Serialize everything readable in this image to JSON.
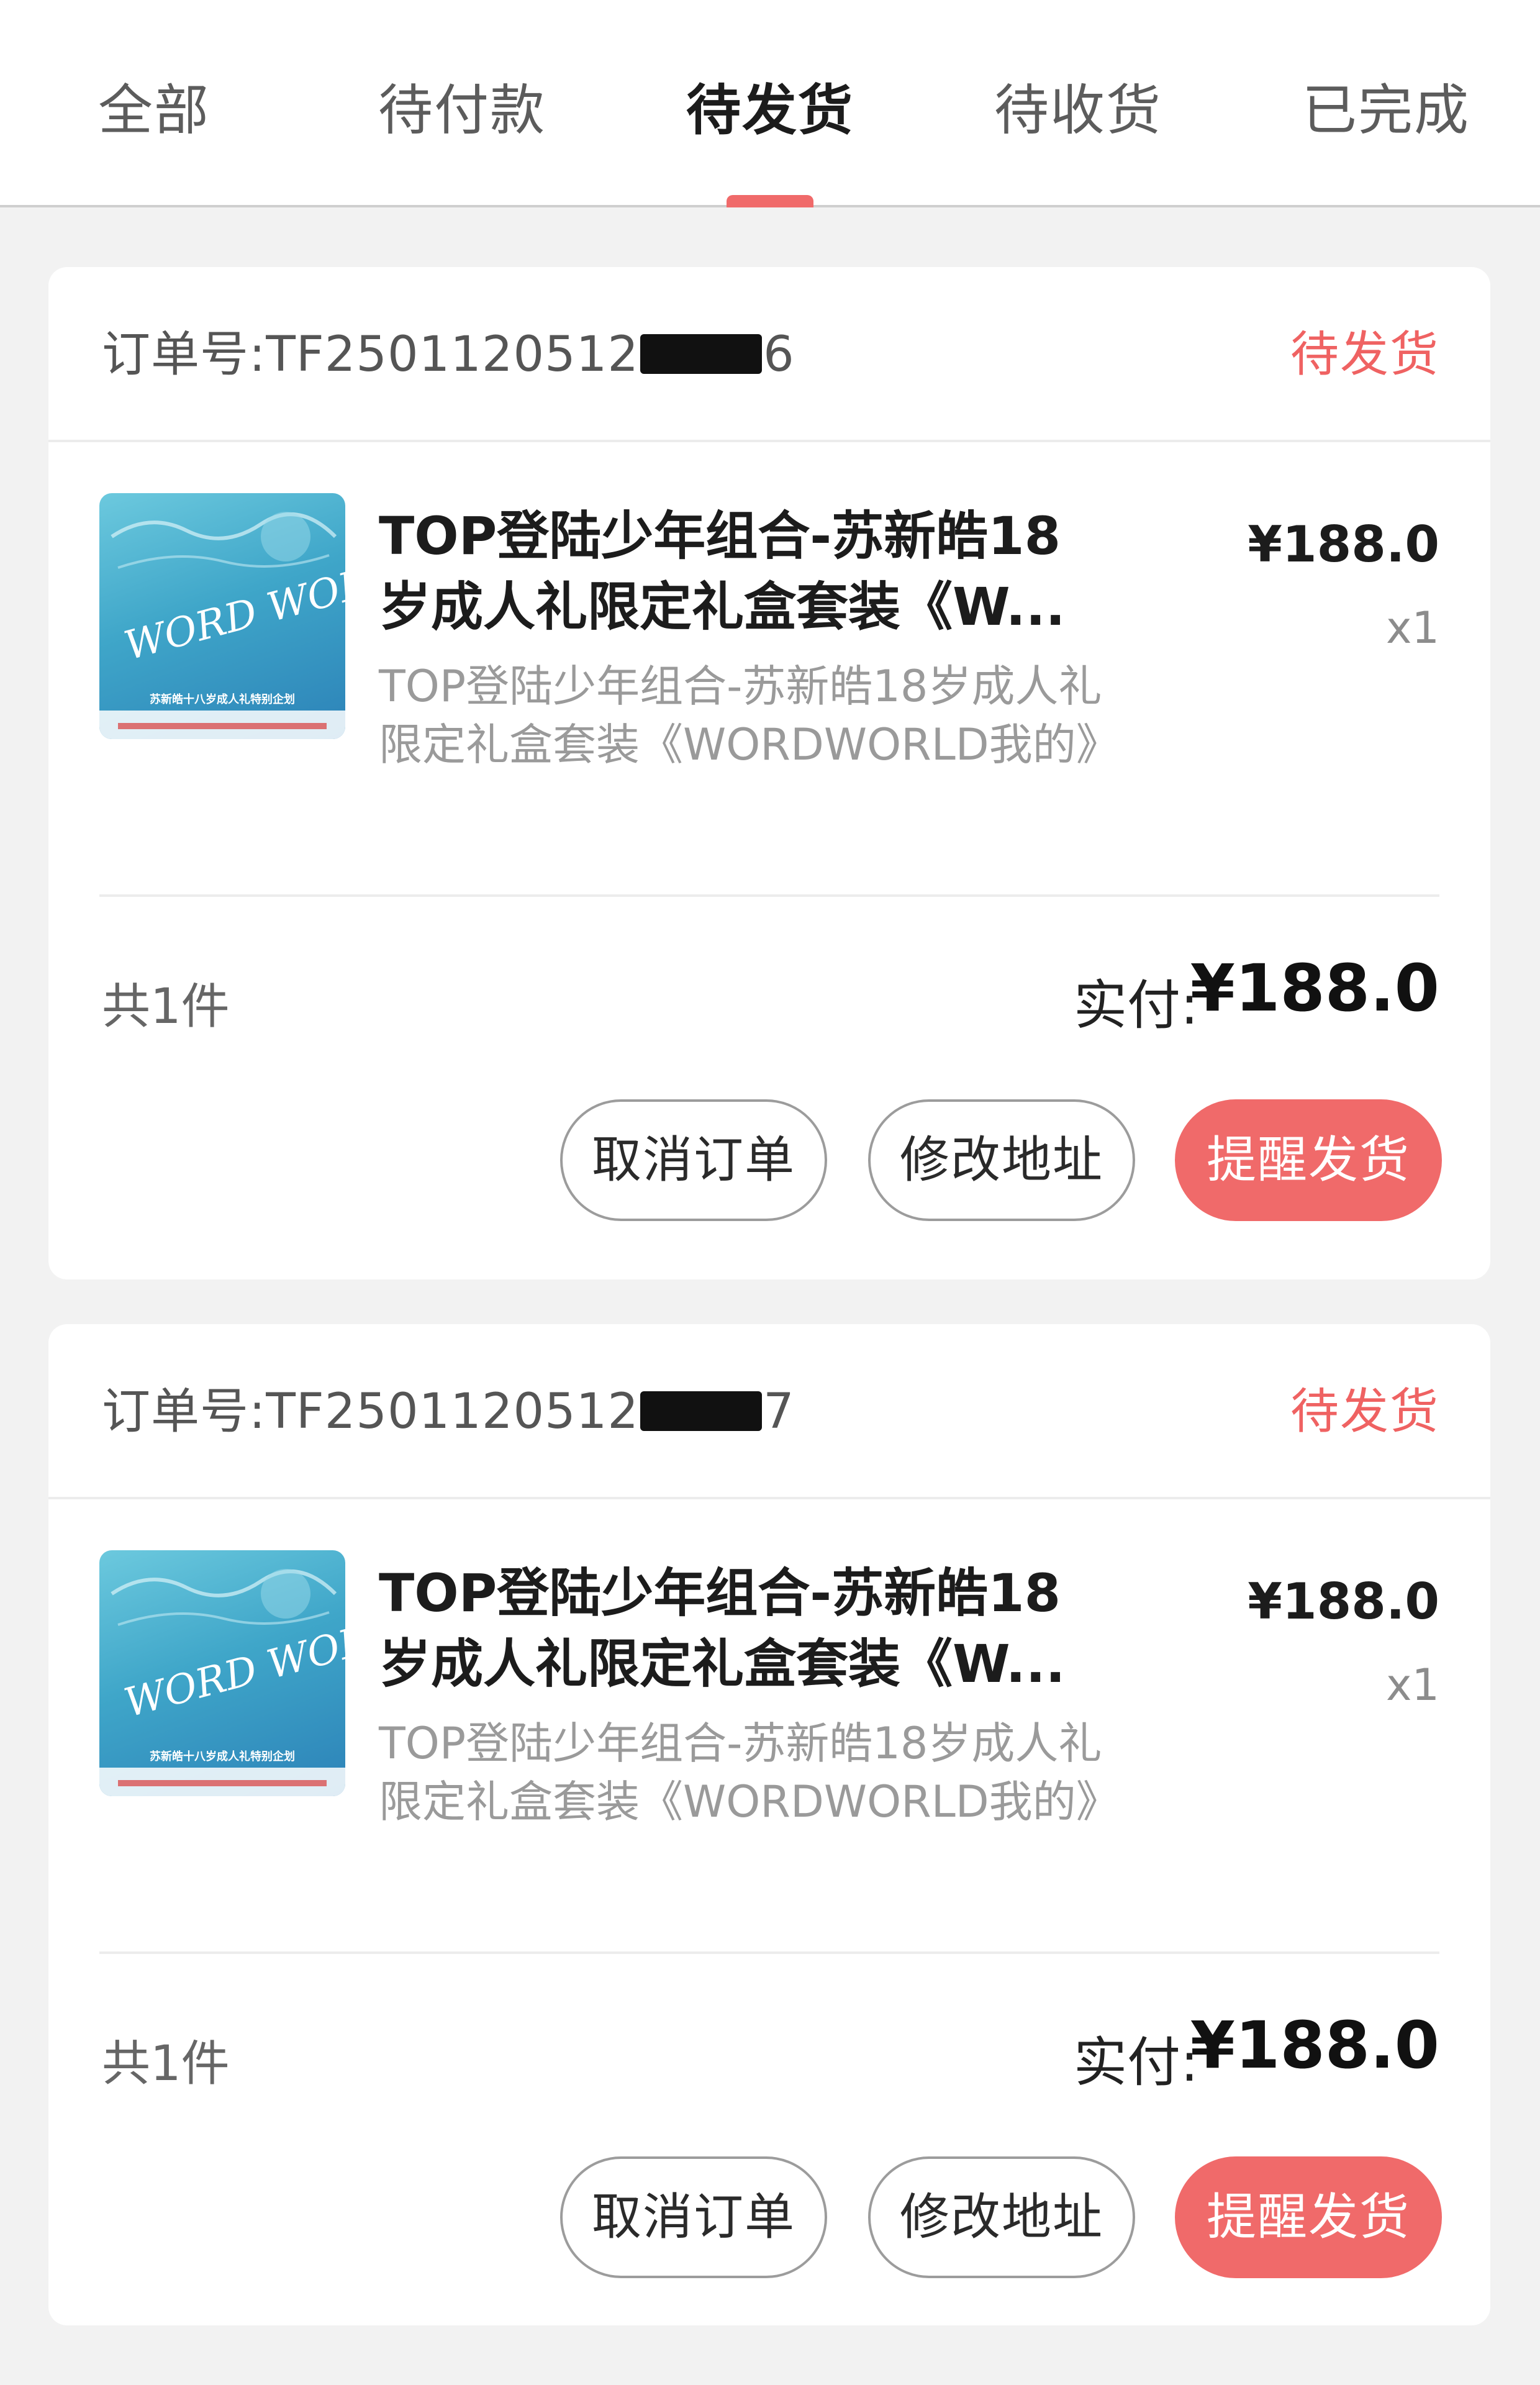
{
  "tabs": [
    {
      "label": "全部",
      "active": false
    },
    {
      "label": "待付款",
      "active": false
    },
    {
      "label": "待发货",
      "active": true
    },
    {
      "label": "待收货",
      "active": false
    },
    {
      "label": "已完成",
      "active": false
    }
  ],
  "colors": {
    "accent": "#f06a6a",
    "status": "#ef6262"
  },
  "orders": [
    {
      "order_prefix": "订单号:TF2501120512",
      "order_suffix": "6",
      "status": "待发货",
      "product": {
        "image_icon": "product-thumbnail-icon",
        "thumb_text": "WORD WORLD 我的",
        "thumb_caption": "苏新皓十八岁成人礼特别企划",
        "title": "TOP登陆少年组合-苏新皓18岁成人礼限定礼盒套装《W...",
        "subtitle": "TOP登陆少年组合-苏新皓18岁成人礼限定礼盒套装《WORDWORLD我的》",
        "price": "¥188.0",
        "qty": "x1"
      },
      "count": "共1件",
      "total_label": "实付:",
      "total_value": "¥188.0",
      "buttons": {
        "cancel": "取消订单",
        "address": "修改地址",
        "remind": "提醒发货"
      }
    },
    {
      "order_prefix": "订单号:TF2501120512",
      "order_suffix": "7",
      "status": "待发货",
      "product": {
        "image_icon": "product-thumbnail-icon",
        "thumb_text": "WORD WORLD 我的",
        "thumb_caption": "苏新皓十八岁成人礼特别企划",
        "title": "TOP登陆少年组合-苏新皓18岁成人礼限定礼盒套装《W...",
        "subtitle": "TOP登陆少年组合-苏新皓18岁成人礼限定礼盒套装《WORDWORLD我的》",
        "price": "¥188.0",
        "qty": "x1"
      },
      "count": "共1件",
      "total_label": "实付:",
      "total_value": "¥188.0",
      "buttons": {
        "cancel": "取消订单",
        "address": "修改地址",
        "remind": "提醒发货"
      }
    }
  ]
}
